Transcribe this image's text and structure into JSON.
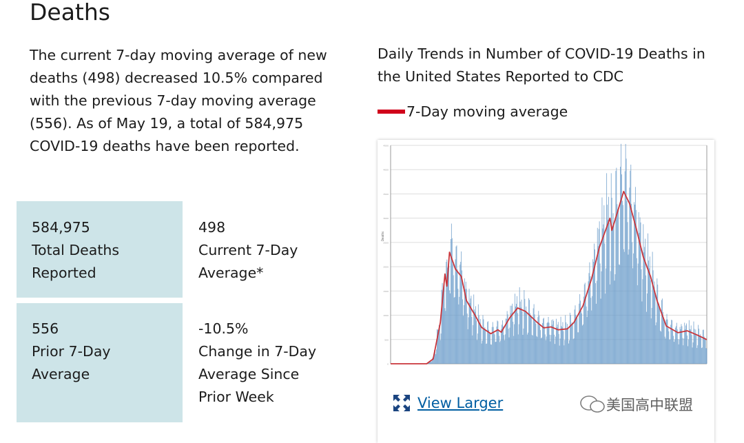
{
  "section_title": "Deaths",
  "intro_text": "The current 7-day moving average of new deaths (498) decreased 10.5% compared with the previous 7-day moving average (556). As of May 19, a total of 584,975 COVID-19 deaths have been reported.",
  "stats": [
    {
      "value": "584,975",
      "label_lines": [
        "Total Deaths",
        "Reported"
      ]
    },
    {
      "value": "498",
      "label_lines": [
        "Current 7-Day",
        "Average*"
      ]
    },
    {
      "value": "556",
      "label_lines": [
        "Prior 7-Day",
        "Average"
      ]
    },
    {
      "value": "-10.5%",
      "label_lines": [
        "Change in 7-Day",
        "Average Since",
        "Prior Week"
      ]
    }
  ],
  "chart_heading": "Daily Trends in Number of COVID-19 Deaths in the United States Reported to CDC",
  "legend_label": "7-Day moving average",
  "view_larger_label": "View Larger",
  "view_larger_icon": "expand-arrows-icon",
  "watermark": "美国高中联盟",
  "colors": {
    "box": "#cde4e8",
    "line": "#d0021b",
    "bars": "#6f9fcb",
    "link": "#005ea2"
  },
  "chart_data": {
    "type": "bar+line",
    "ylabel": "Deaths",
    "ylim": [
      0,
      4500
    ],
    "yticks": [
      0,
      500,
      1000,
      1500,
      2000,
      2500,
      3000,
      3500,
      4000,
      4500
    ],
    "xlim": [
      "2020-01-22",
      "2021-05-19"
    ],
    "grid": true,
    "series": [
      {
        "name": "7-Day moving average",
        "type": "line",
        "x": [
          "2020-01-22",
          "2020-03-17",
          "2020-03-27",
          "2020-04-07",
          "2020-04-14",
          "2020-04-17",
          "2020-04-21",
          "2020-04-30",
          "2020-05-09",
          "2020-05-17",
          "2020-05-30",
          "2020-06-09",
          "2020-06-23",
          "2020-07-04",
          "2020-07-09",
          "2020-07-22",
          "2020-08-03",
          "2020-08-15",
          "2020-09-02",
          "2020-09-12",
          "2020-09-23",
          "2020-10-04",
          "2020-10-18",
          "2020-10-28",
          "2020-11-11",
          "2020-11-24",
          "2020-12-06",
          "2020-12-22",
          "2020-12-25",
          "2021-01-03",
          "2021-01-12",
          "2021-01-21",
          "2021-01-31",
          "2021-02-11",
          "2021-02-22",
          "2021-03-04",
          "2021-03-18",
          "2021-04-05",
          "2021-04-19",
          "2021-05-03",
          "2021-05-19"
        ],
        "values": [
          0,
          0,
          100,
          850,
          1850,
          1600,
          2300,
          1950,
          1800,
          1300,
          1000,
          750,
          620,
          700,
          650,
          950,
          1150,
          1080,
          850,
          740,
          760,
          700,
          720,
          850,
          1200,
          1750,
          2400,
          3000,
          2750,
          3150,
          3550,
          3300,
          2800,
          2200,
          1800,
          1300,
          780,
          640,
          680,
          600,
          498
        ]
      }
    ]
  }
}
